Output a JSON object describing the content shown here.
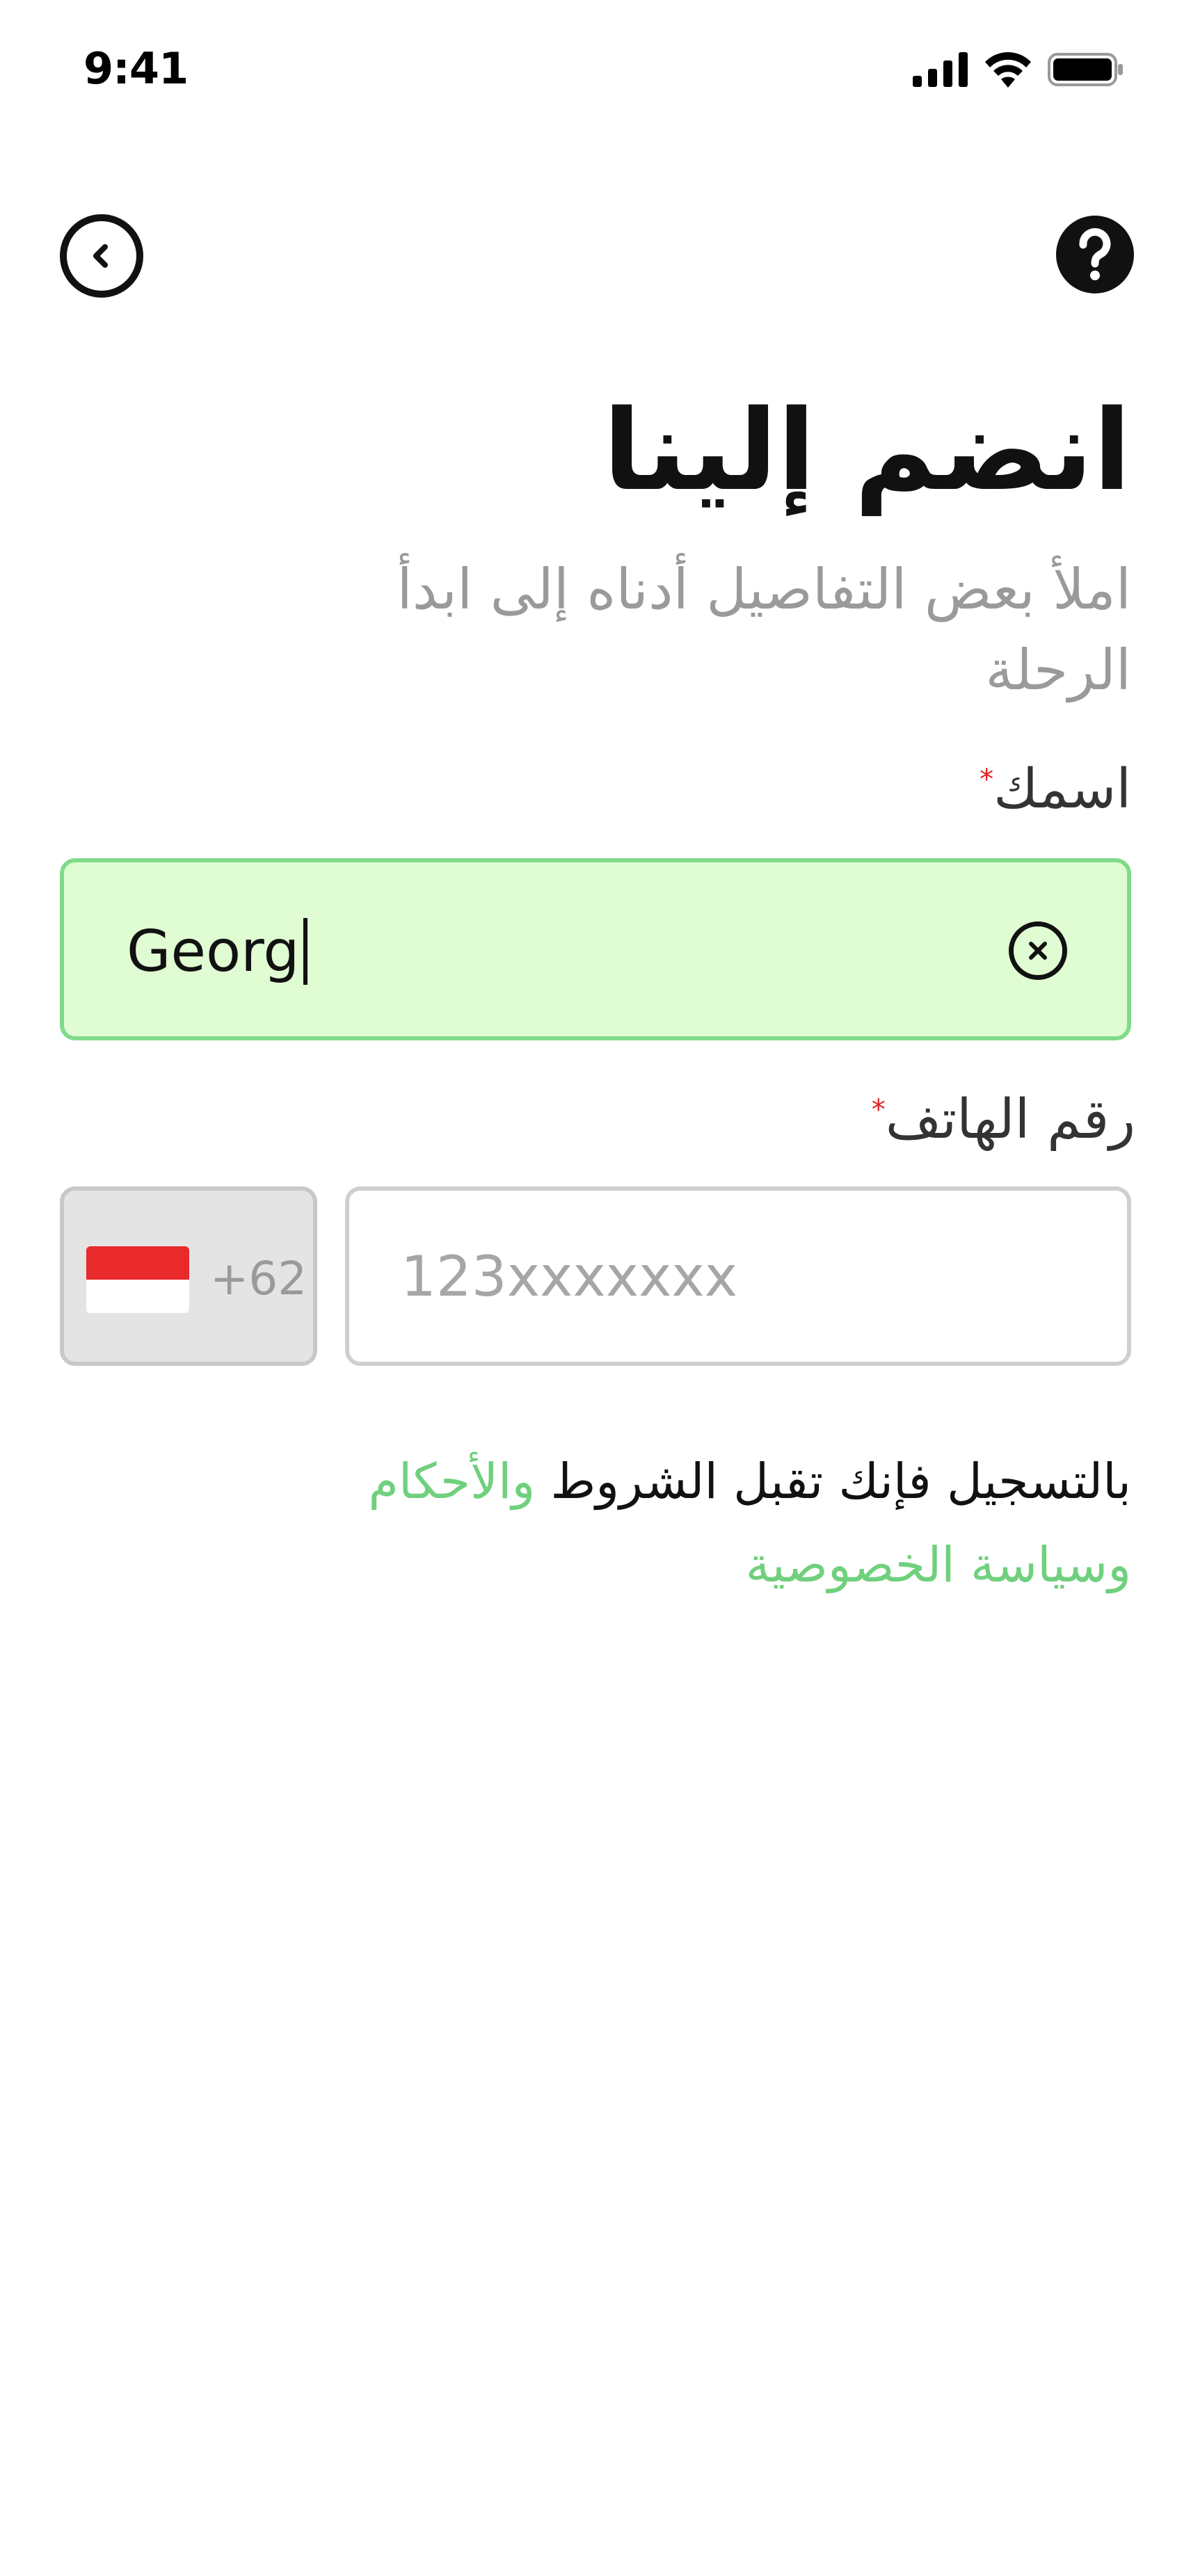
{
  "status_bar": {
    "time": "9:41",
    "icons": [
      "signal-icon",
      "wifi-icon",
      "battery-icon"
    ]
  },
  "header": {
    "back_icon": "chevron-left-icon",
    "help_icon": "help-icon"
  },
  "title": "انضم إلينا",
  "subtitle": "املأ بعض التفاصيل أدناه إلى ابدأ الرحلة",
  "form": {
    "name_label": "اسمك",
    "name_value": "Georg",
    "phone_label": "رقم الهاتف",
    "required_mark": "*",
    "country_code": "+62",
    "phone_placeholder": "123xxxxxxx",
    "phone_value": ""
  },
  "terms": {
    "prefix": "بالتسجيل فإنك تقبل الشروط",
    "terms_link": "والأحكام",
    "privacy_link": "وسياسة الخصوصية"
  },
  "colors": {
    "accent_green": "#6fd07d",
    "field_active_bg": "#e0fcd2",
    "field_active_border": "#7fdb8a",
    "required_red": "#e02020",
    "flag_red": "#e82a2a"
  }
}
